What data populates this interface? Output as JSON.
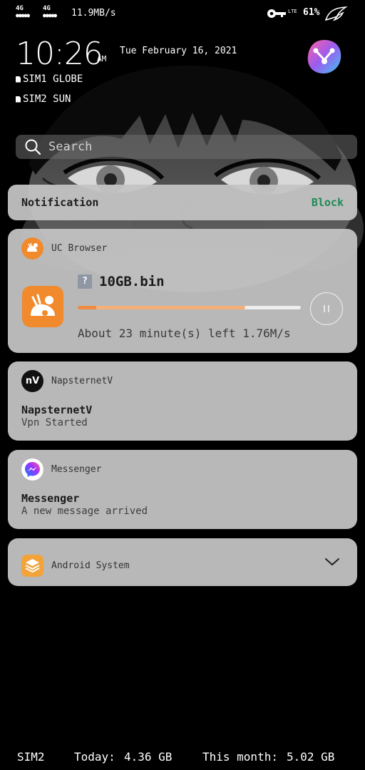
{
  "status_bar": {
    "net1": "4G",
    "net2": "4G",
    "speed": "11.9MB/s",
    "lte": "LTE",
    "battery": "61%",
    "icons": [
      "signal-icon",
      "key-icon",
      "rog-logo-icon"
    ]
  },
  "lockscreen": {
    "time": "10:26",
    "ampm": "AM",
    "date": "Tue February 16, 2021",
    "sim1": "SIM1 GLOBE",
    "sim2": "SIM2 SUN"
  },
  "search": {
    "placeholder": "Search"
  },
  "notification_header": {
    "title": "Notification",
    "action": "Block",
    "action_color": "#1f8a55"
  },
  "notifications": {
    "uc": {
      "app": "UC Browser",
      "file_icon": "?",
      "file": "10GB.bin",
      "progress": 0.75,
      "eta": "About 23 minute(s) left",
      "speed": "1.76M/s"
    },
    "vpn": {
      "app_icon_text": "nV",
      "app": "NapsternetV",
      "title": "NapsternetV",
      "text": "Vpn Started"
    },
    "messenger": {
      "app": "Messenger",
      "title": "Messenger",
      "text": "A new message arrived"
    },
    "system": {
      "app": "Android System"
    }
  },
  "usage": {
    "sim": "SIM2",
    "today_label": "Today:",
    "today": "4.36 GB",
    "month_label": "This month:",
    "month": "5.02 GB"
  },
  "colors": {
    "uc_orange": "#f08a2c",
    "progress_fill": "#f5b07a",
    "progress_lead": "#ef8a3f",
    "block_green": "#1f8a55"
  }
}
